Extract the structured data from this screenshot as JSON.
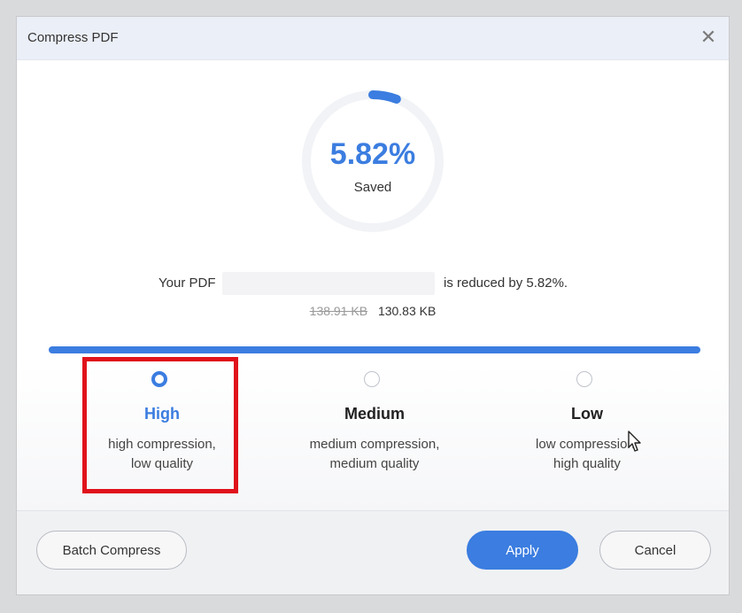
{
  "dialog": {
    "title": "Compress PDF",
    "close_icon": "close-icon"
  },
  "summary": {
    "percent_saved": "5.82%",
    "saved_label": "Saved",
    "ring_fraction": 0.0582,
    "reduce_prefix": "Your PDF",
    "reduce_suffix": "is reduced by  5.82%.",
    "original_size": "138.91 KB",
    "new_size": "130.83 KB"
  },
  "compression": {
    "slider_fraction": 1.0,
    "options": [
      {
        "name": "High",
        "description_line1": "high compression,",
        "description_line2": "low quality",
        "selected": true
      },
      {
        "name": "Medium",
        "description_line1": "medium compression,",
        "description_line2": "medium quality",
        "selected": false
      },
      {
        "name": "Low",
        "description_line1": "low compression,",
        "description_line2": "high quality",
        "selected": false
      }
    ]
  },
  "footer": {
    "batch_label": "Batch Compress",
    "apply_label": "Apply",
    "cancel_label": "Cancel"
  },
  "colors": {
    "accent": "#3b7de0",
    "highlight_box": "#e0121b"
  }
}
